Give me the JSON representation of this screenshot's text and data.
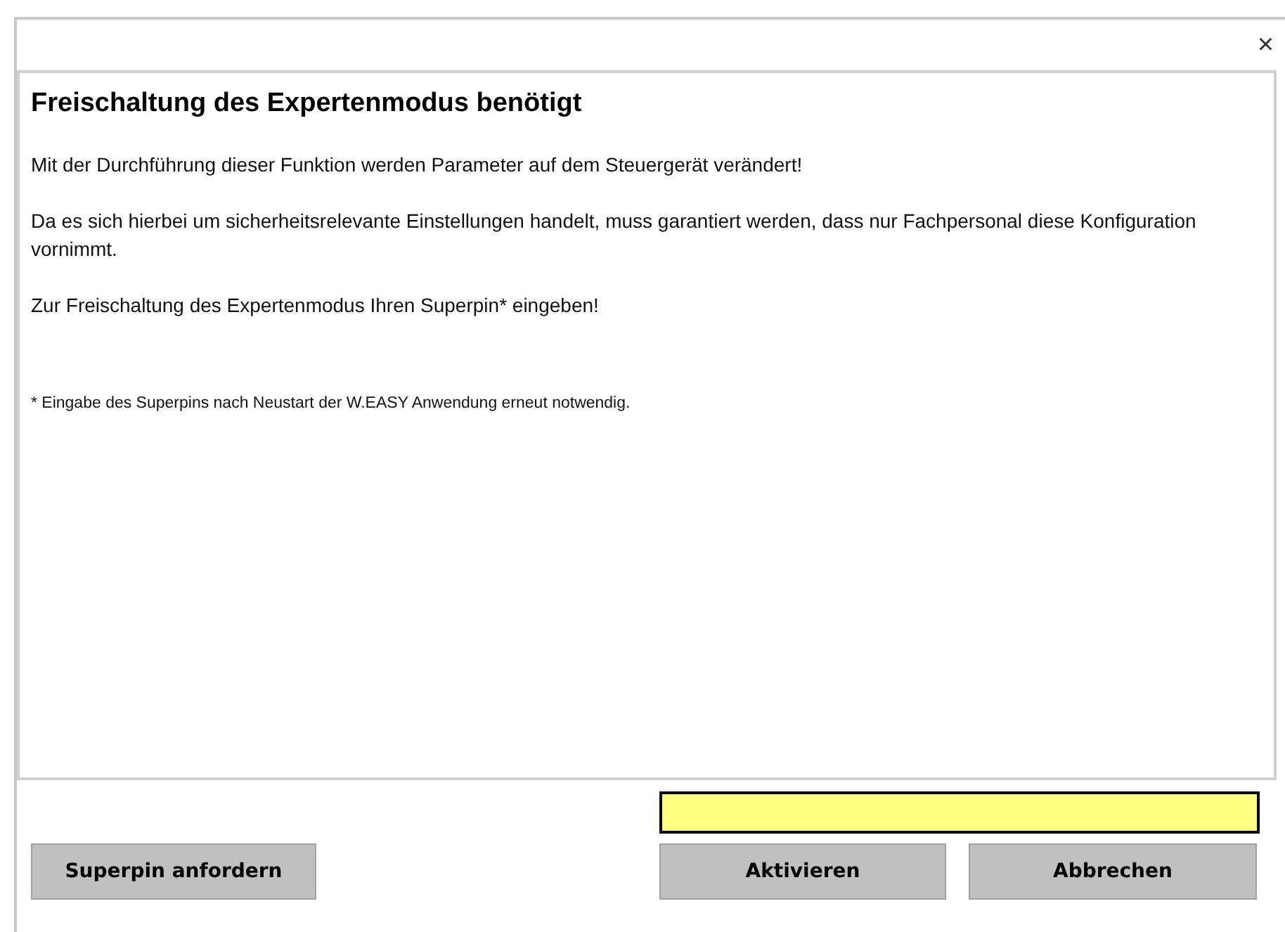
{
  "dialog": {
    "close": "×",
    "title": "Freischaltung des Expertenmodus benötigt",
    "paragraphs": [
      "Mit der Durchführung dieser Funktion werden Parameter auf dem Steuergerät verändert!",
      "Da es sich hierbei um sicherheitsrelevante Einstellungen handelt, muss garantiert werden, dass nur Fachpersonal diese Konfiguration vornimmt.",
      "Zur Freischaltung des Expertenmodus Ihren Superpin* eingeben!"
    ],
    "footnote": "* Eingabe des Superpins nach Neustart der W.EASY Anwendung erneut notwendig.",
    "buttons": [
      "Superpin anfordern",
      "Aktivieren",
      "Abbrechen"
    ]
  }
}
